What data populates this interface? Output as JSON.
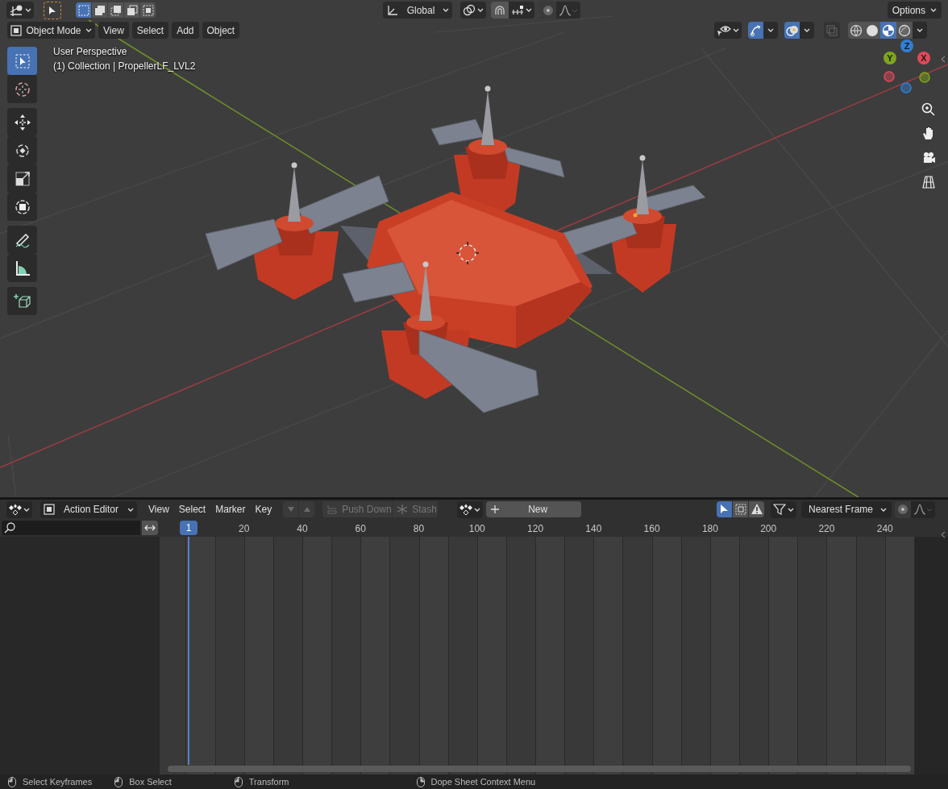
{
  "top_bar": {
    "select_modes": [
      {
        "selected": true
      },
      {
        "selected": false
      },
      {
        "selected": false
      },
      {
        "selected": false
      },
      {
        "selected": false
      }
    ],
    "orientation": "Global",
    "proportional_editing": false,
    "options": "Options"
  },
  "viewport_header": {
    "mode": "Object Mode",
    "menus": [
      "View",
      "Select",
      "Add",
      "Object"
    ],
    "gizmos_on": true,
    "overlays_on": true,
    "xray": false,
    "shading": [
      {
        "kind": "wireframe",
        "selected": false
      },
      {
        "kind": "solid",
        "selected": false
      },
      {
        "kind": "material",
        "selected": true
      },
      {
        "kind": "rendered",
        "selected": false
      }
    ]
  },
  "viewport_info": [
    "User Perspective",
    "(1) Collection | PropellerLF_LVL2"
  ],
  "tools": [
    {
      "kind": "select",
      "selected": true
    },
    {
      "kind": "cursor",
      "selected": false
    },
    {
      "kind": "move",
      "selected": false
    },
    {
      "kind": "rotate",
      "selected": false
    },
    {
      "kind": "scale",
      "selected": false
    },
    {
      "kind": "transform",
      "selected": false
    },
    {
      "kind": "annotate",
      "selected": false
    },
    {
      "kind": "measure",
      "selected": false
    },
    {
      "kind": "add_cube",
      "selected": false
    }
  ],
  "navigation_gizmo": {
    "axes": [
      {
        "label": "X",
        "color": "#e0495a"
      },
      {
        "label": "Y",
        "color": "#7ea61c"
      },
      {
        "label": "Z",
        "color": "#2f7fd6"
      }
    ]
  },
  "action_editor": {
    "editor": "Action Editor",
    "menus": [
      "View",
      "Select",
      "Marker",
      "Key"
    ],
    "push_down": {
      "label": "Push Down",
      "disabled": true
    },
    "stash": {
      "label": "Stash",
      "disabled": true
    },
    "new": "New",
    "filters": [
      {
        "selected": true
      },
      {
        "selected": false
      },
      {
        "selected": false
      }
    ],
    "auto_snap": "Nearest Frame",
    "current_frame": "1",
    "frame_ticks": [
      "20",
      "40",
      "60",
      "80",
      "100",
      "120",
      "140",
      "160",
      "180",
      "200",
      "220",
      "240"
    ]
  },
  "status_bar": [
    {
      "text": "Select Keyframes"
    },
    {
      "text": "Box Select"
    },
    {
      "text": "Transform"
    },
    {
      "text": "Dope Sheet Context Menu"
    }
  ]
}
